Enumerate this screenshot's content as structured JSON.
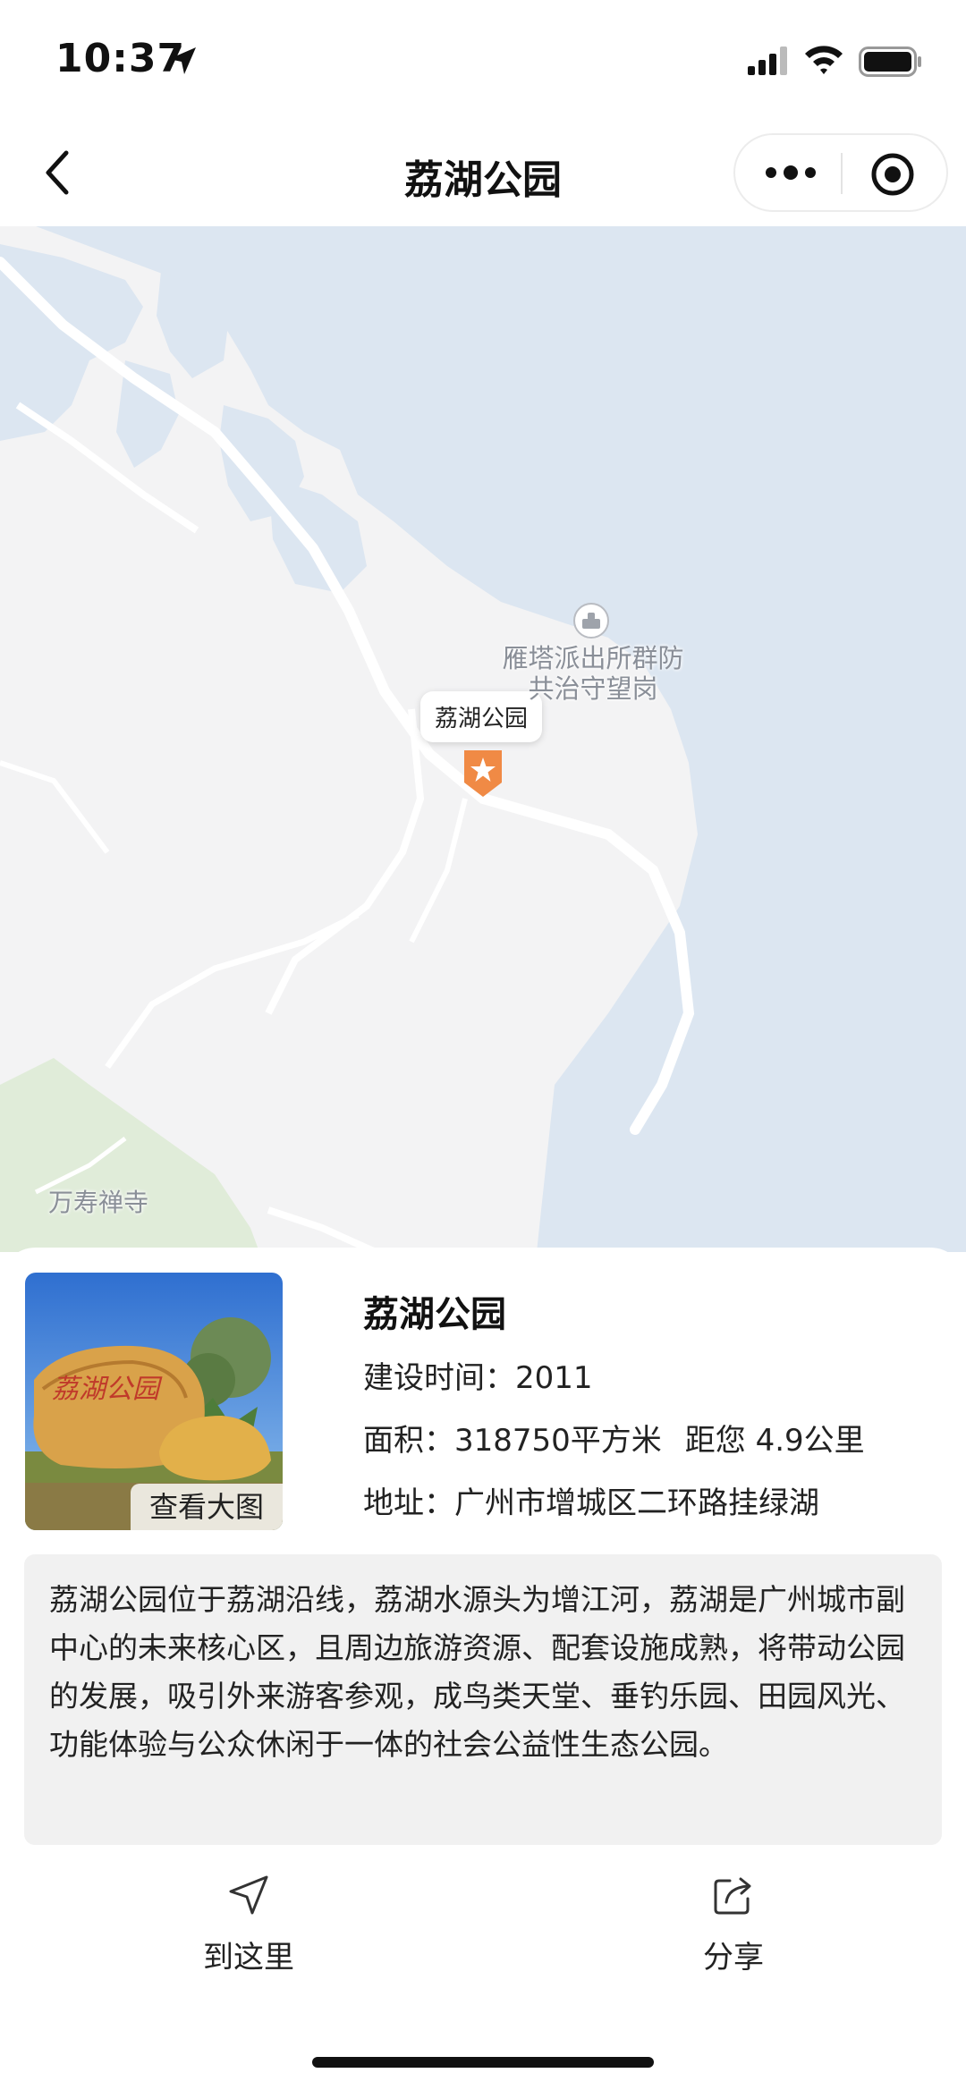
{
  "status_bar": {
    "time": "10:37"
  },
  "nav": {
    "title": "荔湖公园"
  },
  "map": {
    "pin_label": "荔湖公园",
    "police_label_line1": "雁塔派出所群防",
    "police_label_line2": "共治守望岗",
    "temple_label": "万寿禅寺"
  },
  "poi": {
    "photo_button": "查看大图",
    "name": "荔湖公园",
    "build_time": "建设时间：2011",
    "area": "面积：318750平方米",
    "distance": "距您 4.9公里",
    "address": "地址：广州市增城区二环路挂绿湖",
    "description": "荔湖公园位于荔湖沿线，荔湖水源头为增江河，荔湖是广州城市副中心的未来核心区，且周边旅游资源、配套设施成熟，将带动公园的发展，吸引外来游客参观，成鸟类天堂、垂钓乐园、田园风光、功能体验与公众休闲于一体的社会公益性生态公园。"
  },
  "actions": {
    "navigate": "到这里",
    "share": "分享"
  },
  "colors": {
    "water": "#dce6f1",
    "land": "#f3f3f4",
    "green": "#e0ecd9",
    "pin": "#f08a45"
  }
}
